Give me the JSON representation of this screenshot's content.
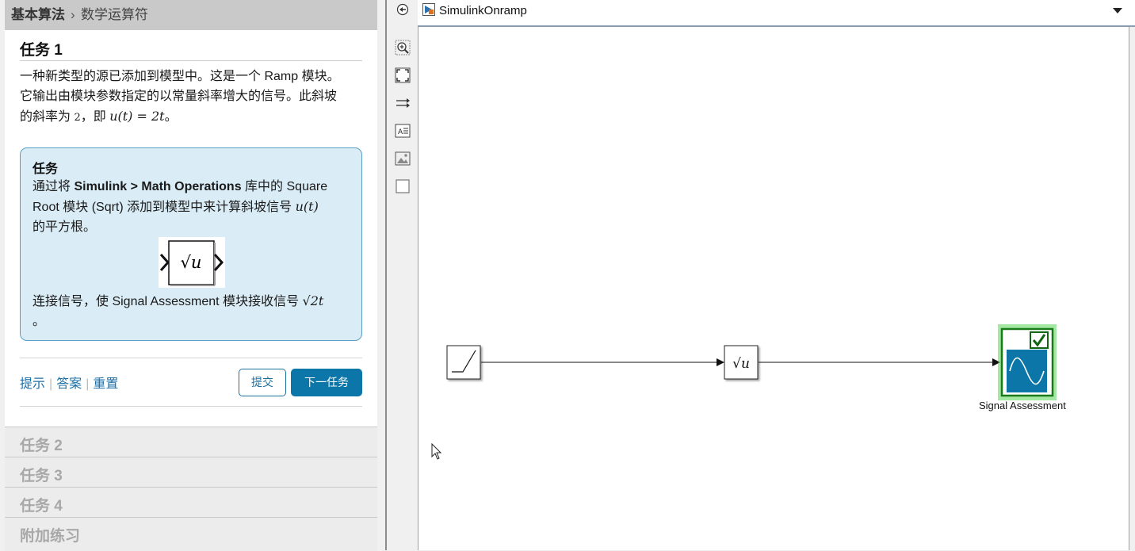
{
  "breadcrumb": {
    "section": "基本算法",
    "separator": "›",
    "page": "数学运算符"
  },
  "task": {
    "title": "任务 1",
    "desc_line1": "一种新类型的源已添加到模型中。这是一个 Ramp 模块。",
    "desc_line2": "它输出由模块参数指定的以常量斜率增大的信号。此斜坡",
    "desc_line3_a": "的斜率为 ",
    "desc_line3_slope": "2",
    "desc_line3_b": "，即 ",
    "desc_line3_eq": "u(t) = 2t",
    "desc_line3_c": "。"
  },
  "taskbox": {
    "header": "任务",
    "text_a": "通过将 ",
    "text_bold": "Simulink > Math Operations",
    "text_b": " 库中的 Square Root 模块 (Sqrt) 添加到模型中来计算斜坡信号 ",
    "text_signal": "u(t)",
    "text_c": "的平方根。",
    "sqrt_symbol": "√u",
    "conn_text": "连接信号，使 Signal Assessment 模块接收信号 ",
    "conn_expr": "√2t",
    "conn_end": "。"
  },
  "actions": {
    "hint": "提示",
    "answer": "答案",
    "reset": "重置",
    "submit": "提交",
    "next": "下一任务"
  },
  "other_tasks": [
    "任务 2",
    "任务 3",
    "任务 4",
    "附加练习"
  ],
  "model": {
    "name": "SimulinkOnramp"
  },
  "blocks": {
    "sqrt_label": "√u",
    "assessment_label": "Signal Assessment"
  },
  "icons": [
    "back-icon",
    "zoom-icon",
    "fit-view-icon",
    "signal-route-icon",
    "annotation-icon",
    "image-icon",
    "area-icon"
  ]
}
